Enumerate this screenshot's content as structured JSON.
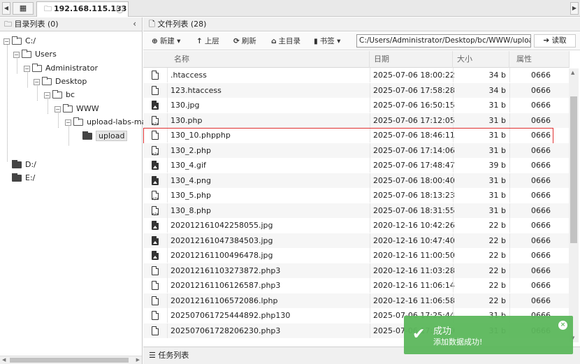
{
  "topbar": {
    "tab_title": "192.168.115.133"
  },
  "left_panel": {
    "title": "目录列表 (0)",
    "tree": [
      {
        "label": "C:/",
        "expanded": true
      },
      {
        "label": "Users",
        "expanded": true
      },
      {
        "label": "Administrator",
        "expanded": true
      },
      {
        "label": "Desktop",
        "expanded": true
      },
      {
        "label": "bc",
        "expanded": true
      },
      {
        "label": "WWW",
        "expanded": true
      },
      {
        "label": "upload-labs-mast",
        "expanded": true
      },
      {
        "label": "upload",
        "selected": true
      },
      {
        "label": "D:/"
      },
      {
        "label": "E:/"
      }
    ]
  },
  "right_panel": {
    "title": "文件列表 (28)",
    "toolbar": {
      "new_label": "新建",
      "up_label": "上层",
      "refresh_label": "刷新",
      "home_label": "主目录",
      "bookmark_label": "书签",
      "path_value": "C:/Users/Administrator/Desktop/bc/WWW/upload-labs-m",
      "read_label": "读取"
    },
    "columns": {
      "name": "名称",
      "date": "日期",
      "size": "大小",
      "perm": "属性"
    },
    "files": [
      {
        "icon": "file",
        "name": ".htaccess",
        "date": "2025-07-06 18:00:22",
        "size": "34 b",
        "perm": "0666"
      },
      {
        "icon": "file",
        "name": "123.htaccess",
        "date": "2025-07-06 17:58:28",
        "size": "34 b",
        "perm": "0666"
      },
      {
        "icon": "image",
        "name": "130.jpg",
        "date": "2025-07-06 16:50:15",
        "size": "31 b",
        "perm": "0666"
      },
      {
        "icon": "code",
        "name": "130.php",
        "date": "2025-07-06 17:12:05",
        "size": "31 b",
        "perm": "0666"
      },
      {
        "icon": "file",
        "name": "130_10.phpphp",
        "date": "2025-07-06 18:46:11",
        "size": "31 b",
        "perm": "0666"
      },
      {
        "icon": "code",
        "name": "130_2.php",
        "date": "2025-07-06 17:14:06",
        "size": "31 b",
        "perm": "0666"
      },
      {
        "icon": "image",
        "name": "130_4.gif",
        "date": "2025-07-06 17:48:47",
        "size": "39 b",
        "perm": "0666"
      },
      {
        "icon": "image",
        "name": "130_4.png",
        "date": "2025-07-06 18:00:40",
        "size": "31 b",
        "perm": "0666"
      },
      {
        "icon": "code",
        "name": "130_5.php",
        "date": "2025-07-06 18:13:23",
        "size": "31 b",
        "perm": "0666"
      },
      {
        "icon": "code",
        "name": "130_8.php",
        "date": "2025-07-06 18:31:55",
        "size": "31 b",
        "perm": "0666"
      },
      {
        "icon": "image",
        "name": "202012161042258055.jpg",
        "date": "2020-12-16 10:42:26",
        "size": "22 b",
        "perm": "0666"
      },
      {
        "icon": "image",
        "name": "202012161047384503.jpg",
        "date": "2020-12-16 10:47:40",
        "size": "22 b",
        "perm": "0666"
      },
      {
        "icon": "image",
        "name": "202012161100496478.jpg",
        "date": "2020-12-16 11:00:50",
        "size": "22 b",
        "perm": "0666"
      },
      {
        "icon": "file",
        "name": "202012161103273872.php3",
        "date": "2020-12-16 11:03:28",
        "size": "22 b",
        "perm": "0666"
      },
      {
        "icon": "file",
        "name": "202012161106126587.php3",
        "date": "2020-12-16 11:06:14",
        "size": "22 b",
        "perm": "0666"
      },
      {
        "icon": "file",
        "name": "202012161106572086.lphp",
        "date": "2020-12-16 11:06:58",
        "size": "22 b",
        "perm": "0666"
      },
      {
        "icon": "file",
        "name": "202507061725444892.php130",
        "date": "2025-07-06 17:25:44",
        "size": "31 b",
        "perm": "0666"
      },
      {
        "icon": "file",
        "name": "202507061728206230.php3",
        "date": "2025-07-06 17:28:20",
        "size": "31 b",
        "perm": "0666"
      }
    ],
    "highlighted_file": "130_10.phpphp"
  },
  "footer": {
    "label": "任务列表"
  },
  "toast": {
    "title": "成功",
    "message": "添加数据成功!",
    "color": "#5cb85c"
  }
}
